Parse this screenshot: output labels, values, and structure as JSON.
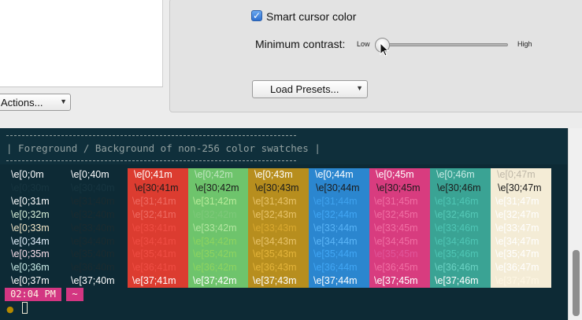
{
  "settings": {
    "smart_cursor_label": "Smart cursor color",
    "smart_cursor_checked": true,
    "min_contrast_label": "Minimum contrast:",
    "slider_low": "Low",
    "slider_high": "High",
    "min_contrast_value": 0.0,
    "load_presets_label": "Load Presets...",
    "actions_label": "Actions..."
  },
  "terminal": {
    "banner": "| Foreground / Background of non-256 color swatches |",
    "prompt_time": "02:04 PM",
    "prompt_dir": "~",
    "prompt_icon": "apple-icon",
    "colors": {
      "base03": "#002b36",
      "base02": "#073642",
      "base01": "#586e75",
      "base0": "#839496",
      "base1": "#93a1a1",
      "base2": "#eee8d5",
      "base3": "#fdf6e3",
      "red": "#dc322f",
      "green": "#66c36a",
      "yellow": "#b58900",
      "blue": "#268bd2",
      "magenta": "#d33682",
      "cyan": "#2aa198",
      "bright_white": "#ffffff"
    },
    "fg_colors": [
      "#ffffff",
      "#1b2b30",
      "#ef4d43",
      "#8ed460",
      "#e3b43a",
      "#41a6f4",
      "#f0407e",
      "#4fc6b5",
      "#fdf6e3"
    ],
    "columns": [
      {
        "bg": "#0d2a35",
        "cells": [
          "\\e[0;0m",
          "\\e[0;30m",
          "\\e[0;31m",
          "\\e[0;32m",
          "\\e[0;33m",
          "\\e[0;34m",
          "\\e[0;35m",
          "\\e[0;36m",
          "\\e[0;37m"
        ]
      },
      {
        "bg": "#0d2a35",
        "cells": [
          "\\e[0;40m",
          "\\e[30;40m",
          "\\e[31;40m",
          "\\e[32;40m",
          "\\e[33;40m",
          "\\e[34;40m",
          "\\e[35;40m",
          "\\e[36;40m",
          "\\e[37;40m"
        ]
      },
      {
        "bg": "#dc3c30",
        "cells": [
          "\\e[0;41m",
          "\\e[30;41m",
          "\\e[31;41m",
          "\\e[32;41m",
          "\\e[33;41m",
          "\\e[34;41m",
          "\\e[35;41m",
          "\\e[36;41m",
          "\\e[37;41m"
        ]
      },
      {
        "bg": "#6ec46c",
        "cells": [
          "\\e[0;42m",
          "\\e[30;42m",
          "\\e[31;42m",
          "\\e[32;42m",
          "\\e[33;42m",
          "\\e[34;42m",
          "\\e[35;42m",
          "\\e[36;42m",
          "\\e[37;42m"
        ]
      },
      {
        "bg": "#b78e1e",
        "cells": [
          "\\e[0;43m",
          "\\e[30;43m",
          "\\e[31;43m",
          "\\e[32;43m",
          "\\e[33;43m",
          "\\e[34;43m",
          "\\e[35;43m",
          "\\e[36;43m",
          "\\e[37;43m"
        ]
      },
      {
        "bg": "#2b86cf",
        "cells": [
          "\\e[0;44m",
          "\\e[30;44m",
          "\\e[31;44m",
          "\\e[32;44m",
          "\\e[33;44m",
          "\\e[34;44m",
          "\\e[35;44m",
          "\\e[36;44m",
          "\\e[37;44m"
        ]
      },
      {
        "bg": "#d83c7f",
        "cells": [
          "\\e[0;45m",
          "\\e[30;45m",
          "\\e[31;45m",
          "\\e[32;45m",
          "\\e[33;45m",
          "\\e[34;45m",
          "\\e[35;45m",
          "\\e[36;45m",
          "\\e[37;45m"
        ]
      },
      {
        "bg": "#3aa394",
        "cells": [
          "\\e[0;46m",
          "\\e[30;46m",
          "\\e[31;46m",
          "\\e[32;46m",
          "\\e[33;46m",
          "\\e[34;46m",
          "\\e[35;46m",
          "\\e[36;46m",
          "\\e[37;46m"
        ]
      },
      {
        "bg": "#f4ecd6",
        "cells": [
          "\\e[0;47m",
          "\\e[30;47m",
          "\\e[31;47m",
          "\\e[32;47m",
          "\\e[33;47m",
          "\\e[34;47m",
          "\\e[35;47m",
          "\\e[36;47m",
          "\\e[37;47m"
        ]
      }
    ],
    "row_colors": [
      [
        "#ffffff",
        "#1b2b30",
        "#ef4d43",
        "#8ed460",
        "#e3b43a",
        "#41a6f4",
        "#f0407e",
        "#4fc6b5",
        "#ffffff"
      ],
      [
        "#ffffff",
        "#1b2b30",
        "#ef4d43",
        "#8ed460",
        "#e3b43a",
        "#41a6f4",
        "#f0407e",
        "#4fc6b5",
        "#ffffff"
      ],
      [
        "#ffffff",
        "#1b2b30",
        "#ef6b63",
        "#b8eb9a",
        "#e8c36a",
        "#3fa2ee",
        "#f06fa4",
        "#4fc6b5",
        "#ffffff"
      ],
      [
        "#d9f0d9",
        "#1b2b30",
        "#ef6b63",
        "#7ec97a",
        "#e8c36a",
        "#41a6f4",
        "#f06fa4",
        "#55c9b7",
        "#ffffff"
      ],
      [
        "#f3e7c8",
        "#1b2b30",
        "#ef4d43",
        "#b3e6a0",
        "#d9a930",
        "#57b2f6",
        "#f06fa4",
        "#4fc6b5",
        "#ffffff"
      ],
      [
        "#e4f1fc",
        "#1b2b30",
        "#ef4d43",
        "#8ed460",
        "#e8c36a",
        "#5cb6f8",
        "#f06fa4",
        "#4fc6b5",
        "#ffffff"
      ],
      [
        "#fbe1ec",
        "#1b2b30",
        "#ef4d43",
        "#8ed460",
        "#e3b43a",
        "#41a6f4",
        "#e0559a",
        "#4fc6b5",
        "#ffffff"
      ],
      [
        "#cdeee9",
        "#1b2b30",
        "#ef4d43",
        "#8ed460",
        "#e3b43a",
        "#41a6f4",
        "#f06fa4",
        "#6bd3c4",
        "#ffffff"
      ],
      [
        "#bdb7a8",
        "#1b2b30",
        "#ef4d43",
        "#8ed460",
        "#e3b43a",
        "#41a6f4",
        "#f0407e",
        "#4fc6b5",
        "#ffffff"
      ]
    ]
  }
}
